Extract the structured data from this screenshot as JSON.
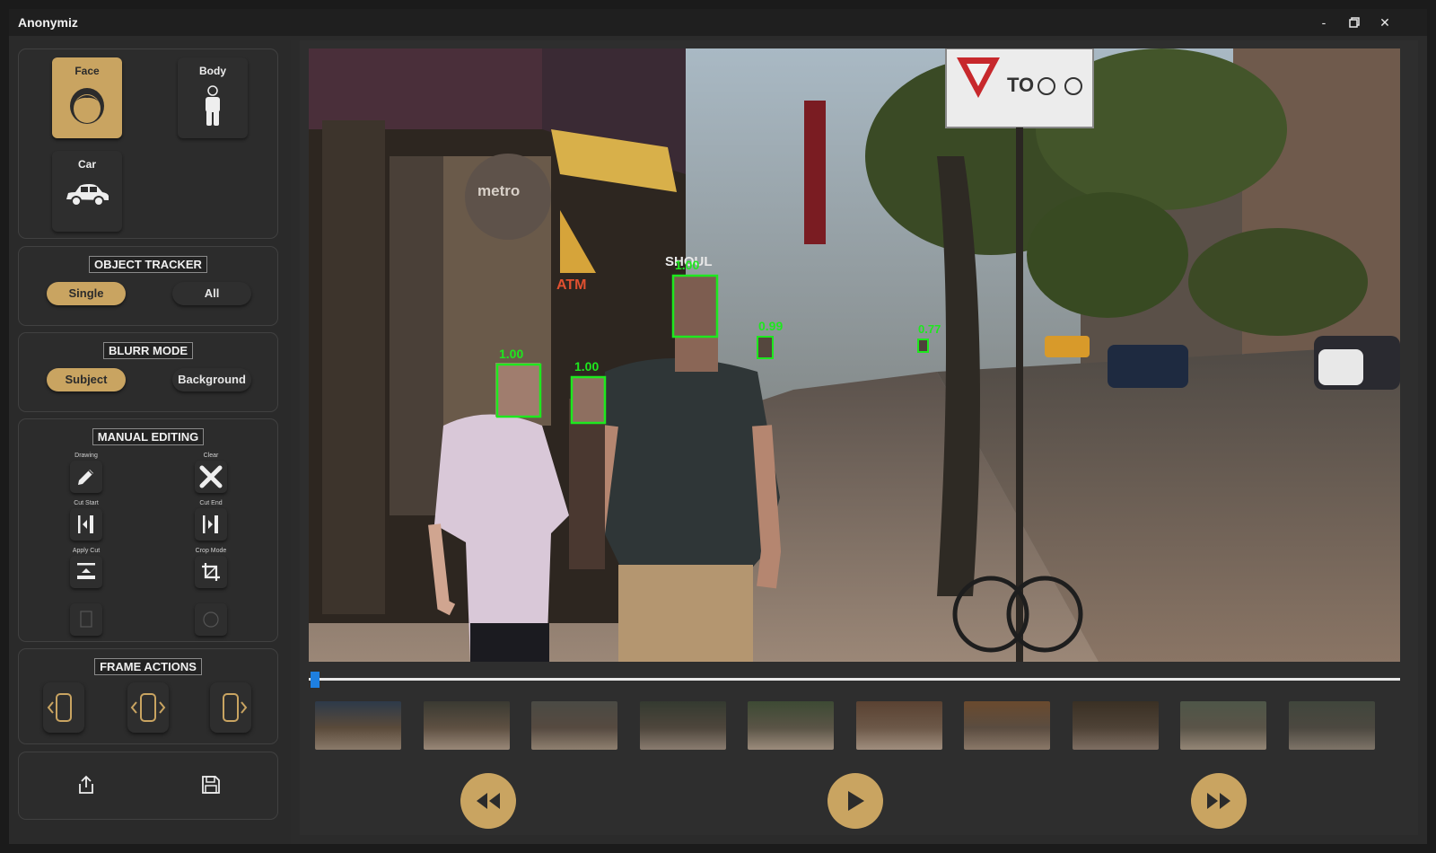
{
  "window": {
    "title": "Anonymiz",
    "minimize": "-",
    "close": "✕"
  },
  "detection": {
    "face": "Face",
    "body": "Body",
    "car": "Car"
  },
  "tracker": {
    "title": "OBJECT TRACKER",
    "single": "Single",
    "all": "All"
  },
  "blur": {
    "title": "BLURR MODE",
    "subject": "Subject",
    "background": "Background"
  },
  "manual": {
    "title": "MANUAL EDITING",
    "drawing": "Drawing",
    "clear": "Clear",
    "cut_start": "Cut Start",
    "cut_end": "Cut End",
    "apply_cut": "Apply Cut",
    "crop_mode": "Crop Mode"
  },
  "frame": {
    "title": "FRAME ACTIONS"
  },
  "video": {
    "detections": [
      "1.00",
      "1.00",
      "1.00",
      "0.99",
      "0.77"
    ],
    "sign_text": "TO",
    "shop_text": "metro",
    "atm_text": "ATM",
    "shop2_text": "SHOUL"
  },
  "playback": {
    "position": 0.0
  },
  "colors": {
    "accent": "#c9a461",
    "detect": "#1ee81e",
    "scrub": "#1e7fe0"
  }
}
